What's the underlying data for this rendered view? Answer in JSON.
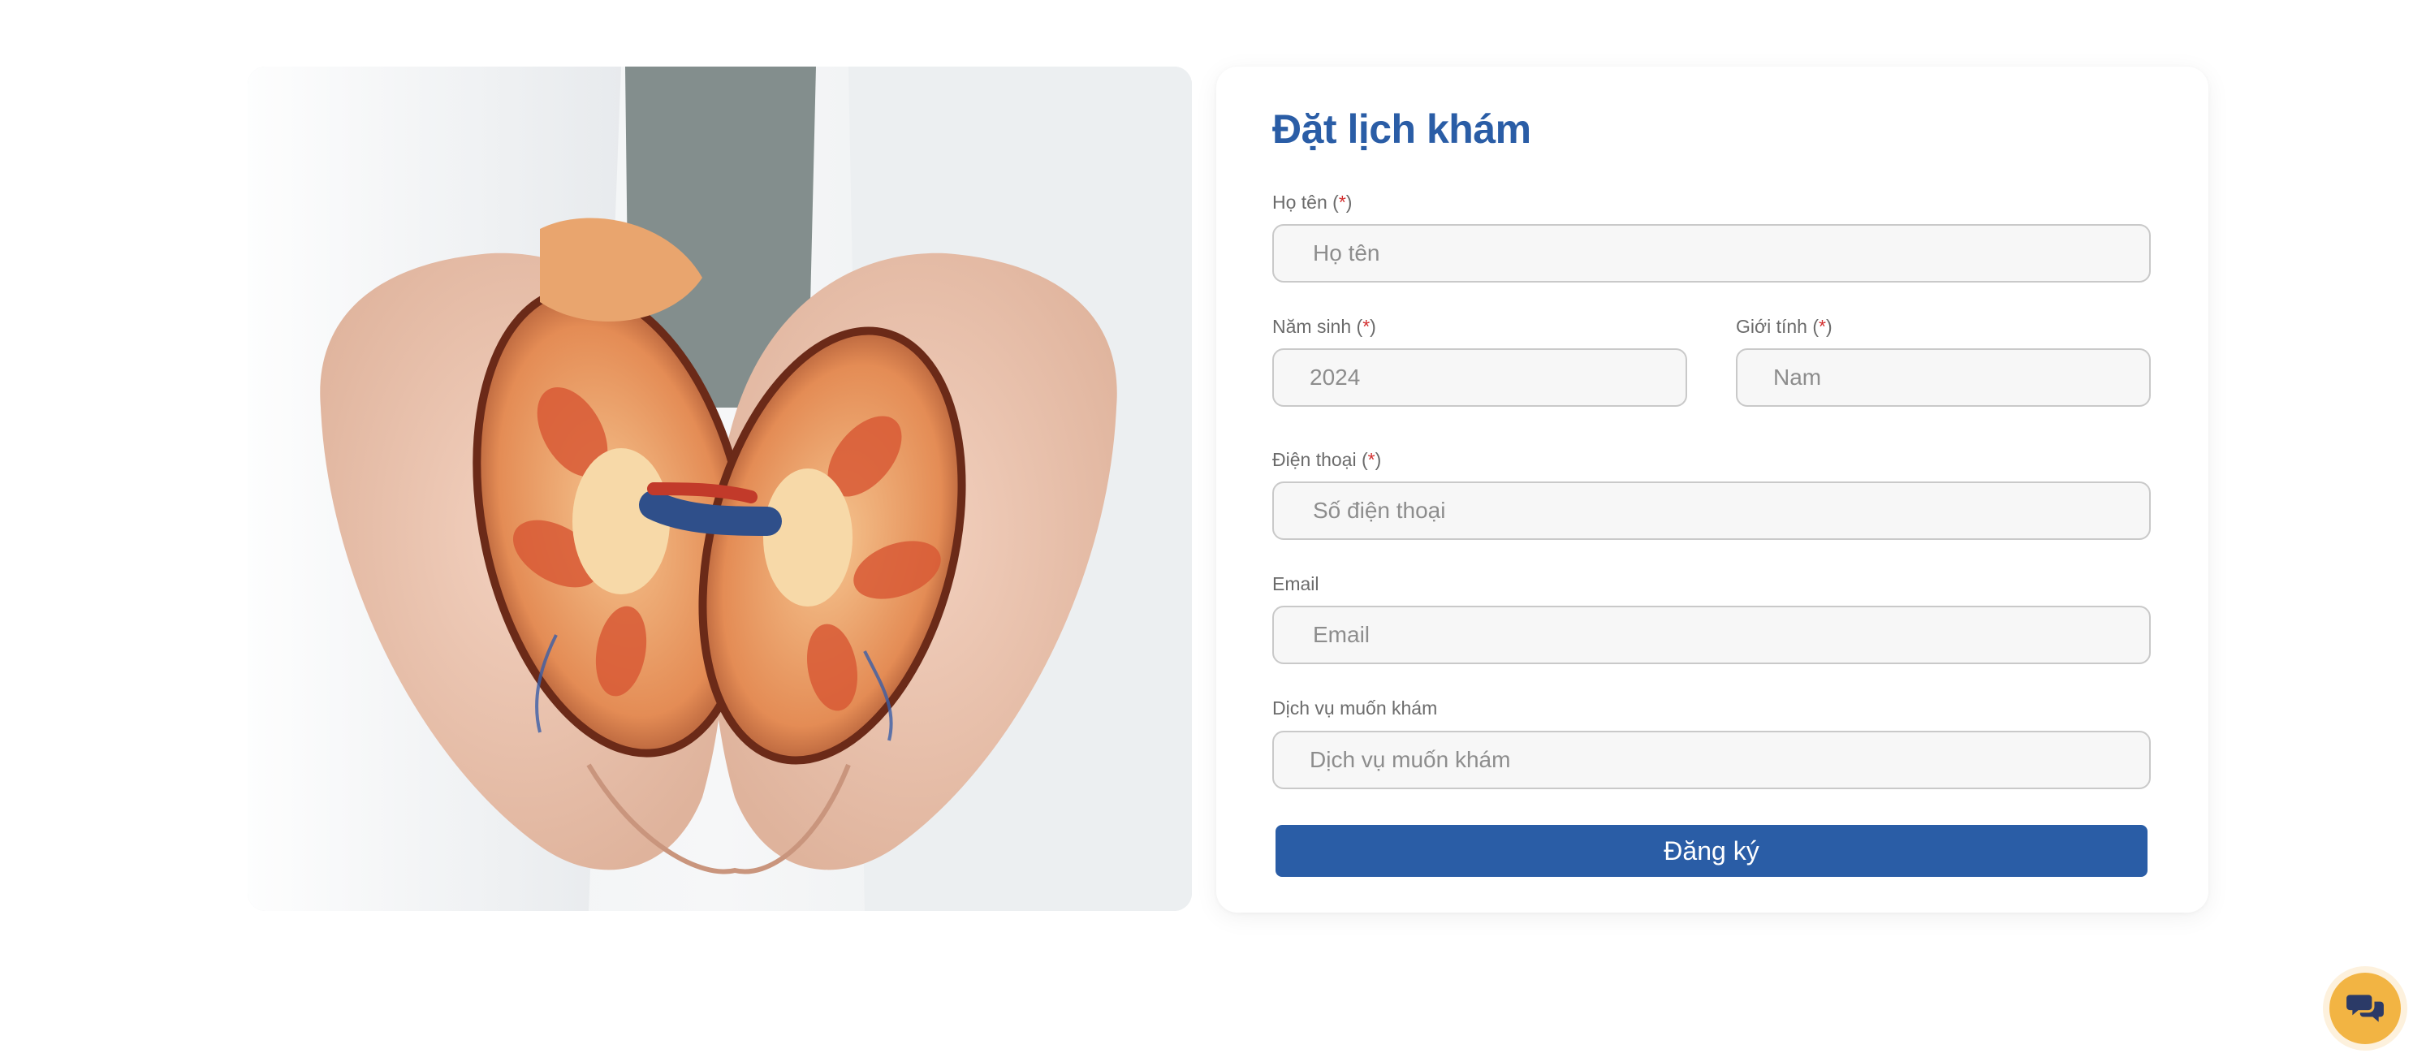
{
  "form": {
    "title": "Đặt lịch khám",
    "required_mark": "*",
    "fields": {
      "name": {
        "label": "Họ tên",
        "placeholder": "Họ tên"
      },
      "birth_year": {
        "label": "Năm sinh",
        "placeholder": "2024"
      },
      "gender": {
        "label": "Giới tính",
        "placeholder": "Nam"
      },
      "phone": {
        "label": "Điện thoại",
        "placeholder": "Số điện thoại"
      },
      "email": {
        "label": "Email",
        "placeholder": "Email"
      },
      "service": {
        "label": "Dịch vụ muốn khám",
        "placeholder": "Dịch vụ muốn khám"
      }
    },
    "submit_label": "Đăng ký"
  },
  "theme": {
    "primary": "#2a5da6",
    "required": "#d32f2f",
    "chat_button": "#f2b443"
  },
  "icons": {
    "chat": "chat-bubbles-icon"
  }
}
